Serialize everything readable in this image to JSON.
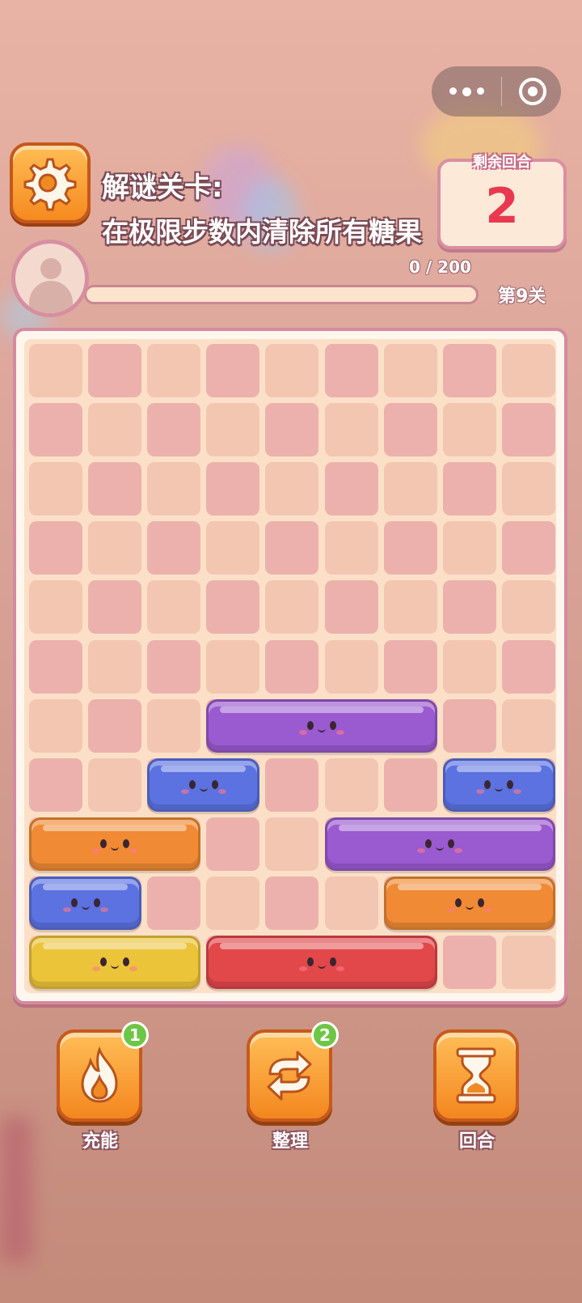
{
  "capsule": {
    "more_icon": "more-dots-icon",
    "close_icon": "target-circle-icon"
  },
  "header": {
    "title_line1": "解谜关卡:",
    "title_line2": "在极限步数内清除所有糖果",
    "settings_icon": "gear-icon"
  },
  "rounds": {
    "label": "剩余回合",
    "value": "2"
  },
  "progress": {
    "text": "0 / 200",
    "current": 0,
    "max": 200,
    "level": "第9关"
  },
  "board": {
    "cols": 9,
    "rows": 11,
    "blocks": [
      {
        "color": "purple",
        "row": 7,
        "col": 4,
        "len": 4
      },
      {
        "color": "blue",
        "row": 8,
        "col": 3,
        "len": 2
      },
      {
        "color": "blue",
        "row": 8,
        "col": 8,
        "len": 2
      },
      {
        "color": "orange",
        "row": 9,
        "col": 1,
        "len": 3
      },
      {
        "color": "purple",
        "row": 9,
        "col": 6,
        "len": 4
      },
      {
        "color": "blue",
        "row": 10,
        "col": 1,
        "len": 2
      },
      {
        "color": "orange",
        "row": 10,
        "col": 7,
        "len": 3
      },
      {
        "color": "yellow",
        "row": 11,
        "col": 1,
        "len": 3
      },
      {
        "color": "red",
        "row": 11,
        "col": 4,
        "len": 4
      }
    ],
    "colors": {
      "purple": "#9a5ad0",
      "blue": "#5b72e0",
      "orange": "#f08a34",
      "yellow": "#ecc43a",
      "red": "#e2474a"
    }
  },
  "tools": [
    {
      "label": "充能",
      "badge": "1",
      "icon": "flame-icon"
    },
    {
      "label": "整理",
      "badge": "2",
      "icon": "shuffle-arrows-icon"
    },
    {
      "label": "回合",
      "badge": "",
      "icon": "hourglass-icon"
    }
  ]
}
